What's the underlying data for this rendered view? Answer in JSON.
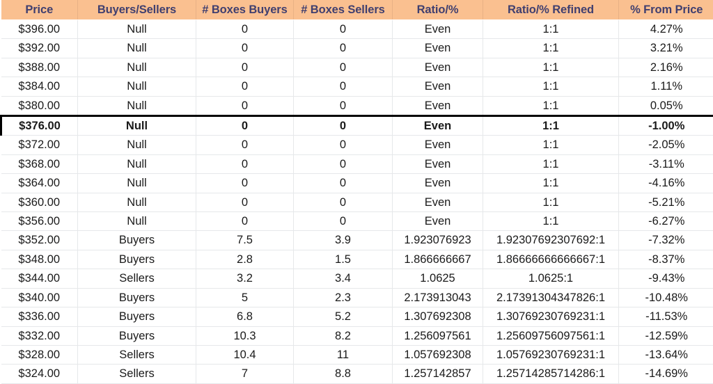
{
  "table": {
    "columns": [
      {
        "key": "price",
        "label": "Price"
      },
      {
        "key": "side",
        "label": "Buyers/Sellers"
      },
      {
        "key": "boxes_buy",
        "label": "# Boxes Buyers"
      },
      {
        "key": "boxes_sell",
        "label": "# Boxes Sellers"
      },
      {
        "key": "ratio",
        "label": "Ratio/%"
      },
      {
        "key": "ratio_ref",
        "label": "Ratio/% Refined"
      },
      {
        "key": "from_price",
        "label": "% From Price"
      }
    ],
    "colors": {
      "header_background": "#FAC090",
      "header_text": "#403F6F",
      "null_background": "#FDE9A4",
      "null_text": "#9E7A1E",
      "buyers_background": "#C3E9CB",
      "buyers_text": "#1D7A2A",
      "sellers_background": "#FBC6CE",
      "sellers_text": "#C0003C",
      "highlight_border": "#000000",
      "grid_line": "#E6E8EA"
    },
    "rows": [
      {
        "price": "$396.00",
        "side": "Null",
        "boxes_buy": "0",
        "boxes_sell": "0",
        "ratio": "Even",
        "ratio_ref": "1:1",
        "from_price": "4.27%",
        "highlight": false
      },
      {
        "price": "$392.00",
        "side": "Null",
        "boxes_buy": "0",
        "boxes_sell": "0",
        "ratio": "Even",
        "ratio_ref": "1:1",
        "from_price": "3.21%",
        "highlight": false
      },
      {
        "price": "$388.00",
        "side": "Null",
        "boxes_buy": "0",
        "boxes_sell": "0",
        "ratio": "Even",
        "ratio_ref": "1:1",
        "from_price": "2.16%",
        "highlight": false
      },
      {
        "price": "$384.00",
        "side": "Null",
        "boxes_buy": "0",
        "boxes_sell": "0",
        "ratio": "Even",
        "ratio_ref": "1:1",
        "from_price": "1.11%",
        "highlight": false
      },
      {
        "price": "$380.00",
        "side": "Null",
        "boxes_buy": "0",
        "boxes_sell": "0",
        "ratio": "Even",
        "ratio_ref": "1:1",
        "from_price": "0.05%",
        "highlight": false
      },
      {
        "price": "$376.00",
        "side": "Null",
        "boxes_buy": "0",
        "boxes_sell": "0",
        "ratio": "Even",
        "ratio_ref": "1:1",
        "from_price": "-1.00%",
        "highlight": true
      },
      {
        "price": "$372.00",
        "side": "Null",
        "boxes_buy": "0",
        "boxes_sell": "0",
        "ratio": "Even",
        "ratio_ref": "1:1",
        "from_price": "-2.05%",
        "highlight": false
      },
      {
        "price": "$368.00",
        "side": "Null",
        "boxes_buy": "0",
        "boxes_sell": "0",
        "ratio": "Even",
        "ratio_ref": "1:1",
        "from_price": "-3.11%",
        "highlight": false
      },
      {
        "price": "$364.00",
        "side": "Null",
        "boxes_buy": "0",
        "boxes_sell": "0",
        "ratio": "Even",
        "ratio_ref": "1:1",
        "from_price": "-4.16%",
        "highlight": false
      },
      {
        "price": "$360.00",
        "side": "Null",
        "boxes_buy": "0",
        "boxes_sell": "0",
        "ratio": "Even",
        "ratio_ref": "1:1",
        "from_price": "-5.21%",
        "highlight": false
      },
      {
        "price": "$356.00",
        "side": "Null",
        "boxes_buy": "0",
        "boxes_sell": "0",
        "ratio": "Even",
        "ratio_ref": "1:1",
        "from_price": "-6.27%",
        "highlight": false
      },
      {
        "price": "$352.00",
        "side": "Buyers",
        "boxes_buy": "7.5",
        "boxes_sell": "3.9",
        "ratio": "1.923076923",
        "ratio_ref": "1.92307692307692:1",
        "from_price": "-7.32%",
        "highlight": false
      },
      {
        "price": "$348.00",
        "side": "Buyers",
        "boxes_buy": "2.8",
        "boxes_sell": "1.5",
        "ratio": "1.866666667",
        "ratio_ref": "1.86666666666667:1",
        "from_price": "-8.37%",
        "highlight": false
      },
      {
        "price": "$344.00",
        "side": "Sellers",
        "boxes_buy": "3.2",
        "boxes_sell": "3.4",
        "ratio": "1.0625",
        "ratio_ref": "1.0625:1",
        "from_price": "-9.43%",
        "highlight": false
      },
      {
        "price": "$340.00",
        "side": "Buyers",
        "boxes_buy": "5",
        "boxes_sell": "2.3",
        "ratio": "2.173913043",
        "ratio_ref": "2.17391304347826:1",
        "from_price": "-10.48%",
        "highlight": false
      },
      {
        "price": "$336.00",
        "side": "Buyers",
        "boxes_buy": "6.8",
        "boxes_sell": "5.2",
        "ratio": "1.307692308",
        "ratio_ref": "1.30769230769231:1",
        "from_price": "-11.53%",
        "highlight": false
      },
      {
        "price": "$332.00",
        "side": "Buyers",
        "boxes_buy": "10.3",
        "boxes_sell": "8.2",
        "ratio": "1.256097561",
        "ratio_ref": "1.25609756097561:1",
        "from_price": "-12.59%",
        "highlight": false
      },
      {
        "price": "$328.00",
        "side": "Sellers",
        "boxes_buy": "10.4",
        "boxes_sell": "11",
        "ratio": "1.057692308",
        "ratio_ref": "1.05769230769231:1",
        "from_price": "-13.64%",
        "highlight": false
      },
      {
        "price": "$324.00",
        "side": "Sellers",
        "boxes_buy": "7",
        "boxes_sell": "8.8",
        "ratio": "1.257142857",
        "ratio_ref": "1.25714285714286:1",
        "from_price": "-14.69%",
        "highlight": false
      }
    ]
  }
}
